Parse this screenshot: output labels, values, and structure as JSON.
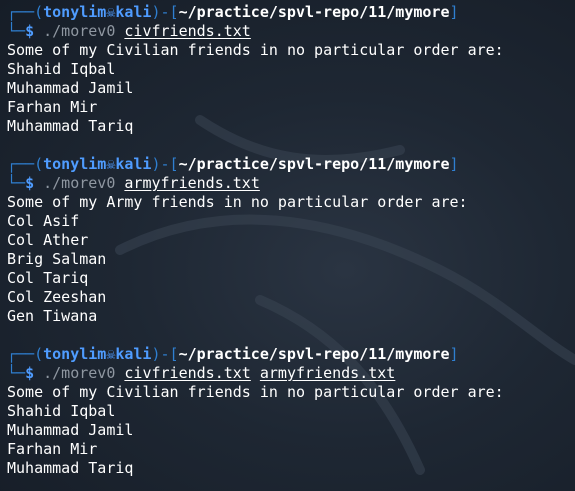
{
  "prompt": {
    "user": "tonylim",
    "host": "kali",
    "path": "~/practice/spvl-repo/11/mymore",
    "symbol": "$",
    "user_host_separator_icon": "skull-icon"
  },
  "blocks": [
    {
      "command": "./morev0",
      "args": [
        "civfriends.txt"
      ],
      "output": [
        "Some of my Civilian friends in no particular order are:",
        "Shahid Iqbal",
        "Muhammad Jamil",
        "Farhan Mir",
        "Muhammad Tariq"
      ]
    },
    {
      "command": "./morev0",
      "args": [
        "armyfriends.txt"
      ],
      "output": [
        "Some of my Army friends in no particular order are:",
        "Col Asif",
        "Col Ather",
        "Brig Salman",
        "Col Tariq",
        "Col Zeeshan",
        "Gen Tiwana"
      ]
    },
    {
      "command": "./morev0",
      "args": [
        "civfriends.txt",
        "armyfriends.txt"
      ],
      "output": [
        "Some of my Civilian friends in no particular order are:",
        "Shahid Iqbal",
        "Muhammad Jamil",
        "Farhan Mir",
        "Muhammad Tariq"
      ]
    }
  ],
  "colors": {
    "background": "#1b2430",
    "prompt_accent": "#4f9cff",
    "frame": "#2f7fd0",
    "command": "#8f97a1",
    "text": "#ffffff"
  }
}
